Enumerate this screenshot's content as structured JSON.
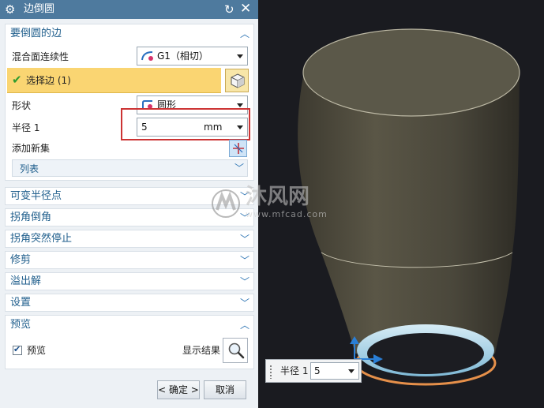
{
  "dialog": {
    "title": "边倒圆",
    "icons": {
      "title": "gear-icon",
      "reset": "reset-icon",
      "close": "close-icon"
    },
    "edges_section": {
      "title": "要倒圆的边",
      "continuity_label": "混合面连续性",
      "continuity_value": "G1（相切）",
      "select_edge_label": "选择边 (1)",
      "shape_label": "形状",
      "shape_value": "圆形",
      "radius_label": "半径 1",
      "radius_value": "5",
      "radius_unit": "mm",
      "add_new_set_label": "添加新集",
      "list_label": "列表"
    },
    "collapsed_sections": [
      "可变半径点",
      "拐角倒角",
      "拐角突然停止",
      "修剪",
      "溢出解",
      "设置"
    ],
    "preview_section": {
      "title": "预览",
      "preview_checkbox_label": "预览",
      "preview_checked": true,
      "show_result_label": "显示结果"
    },
    "ok_label": "< 确定 >",
    "cancel_label": "取消"
  },
  "viewport": {
    "watermark_text": "沐风网",
    "watermark_url": "www.mfcad.com",
    "radius_chip_label": "半径 1",
    "radius_chip_value": "5"
  },
  "colors": {
    "title_bar": "#4e7a9e",
    "section_title": "#1f5e8c",
    "selected_row": "#fad572",
    "highlight_box": "#cc3333",
    "fillet_edge": "#e6904a"
  }
}
